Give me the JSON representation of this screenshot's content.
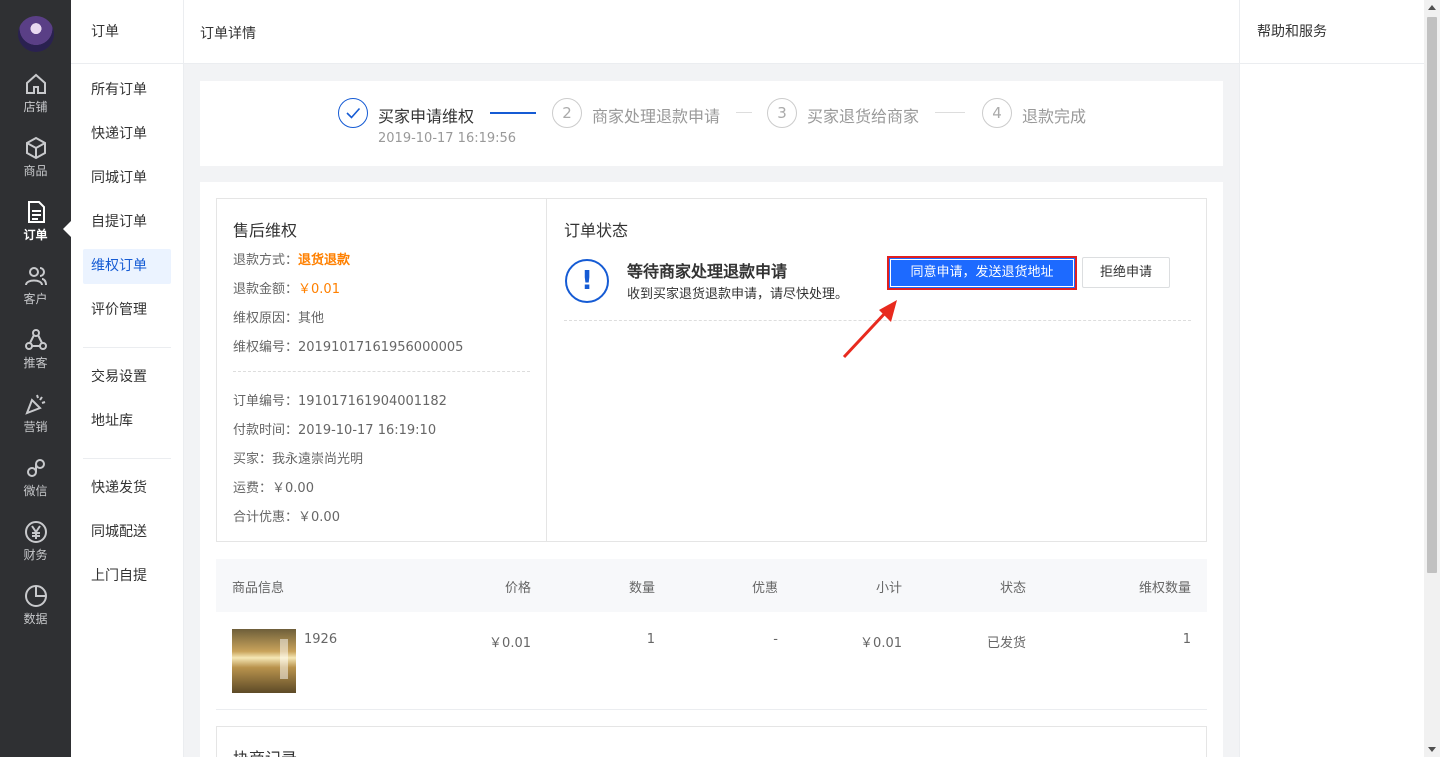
{
  "nav": {
    "items": [
      {
        "label": "店铺",
        "icon": "home-icon"
      },
      {
        "label": "商品",
        "icon": "cube-icon"
      },
      {
        "label": "订单",
        "icon": "document-icon",
        "active": true
      },
      {
        "label": "客户",
        "icon": "users-icon"
      },
      {
        "label": "推客",
        "icon": "share-nodes-icon"
      },
      {
        "label": "营销",
        "icon": "party-popper-icon"
      },
      {
        "label": "微信",
        "icon": "link-icon"
      },
      {
        "label": "财务",
        "icon": "yen-icon"
      },
      {
        "label": "数据",
        "icon": "pie-chart-icon"
      }
    ]
  },
  "sub_nav": {
    "title": "订单",
    "items": [
      "所有订单",
      "快递订单",
      "同城订单",
      "自提订单",
      "维权订单",
      "评价管理",
      "交易设置",
      "地址库",
      "快递发货",
      "同城配送",
      "上门自提"
    ],
    "active_index": 4
  },
  "header": {
    "title": "订单详情"
  },
  "help": {
    "title": "帮助和服务"
  },
  "steps": [
    {
      "index": "✓",
      "label": "买家申请维权",
      "time": "2019-10-17 16:19:56",
      "done": true
    },
    {
      "index": "2",
      "label": "商家处理退款申请"
    },
    {
      "index": "3",
      "label": "买家退货给商家"
    },
    {
      "index": "4",
      "label": "退款完成"
    }
  ],
  "after_sale": {
    "title": "售后维权",
    "refund_method_label": "退款方式：",
    "refund_method": "退货退款",
    "refund_amount_label": "退款金额：",
    "refund_amount": "￥0.01",
    "reason_label": "维权原因：",
    "reason": "其他",
    "case_no_label": "维权编号：",
    "case_no": "20191017161956000005",
    "order_no_label": "订单编号：",
    "order_no": "191017161904001182",
    "pay_time_label": "付款时间：",
    "pay_time": "2019-10-17 16:19:10",
    "buyer_label": "买家：",
    "buyer": "我永遠崇尚光明",
    "shipping_label": "运费：",
    "shipping": "￥0.00",
    "discount_label": "合计优惠：",
    "discount": "￥0.00"
  },
  "order_status": {
    "title": "订单状态",
    "status_title": "等待商家处理退款申请",
    "status_sub": "收到买家退货退款申请，请尽快处理。",
    "agree_button": "同意申请，发送退货地址",
    "reject_button": "拒绝申请"
  },
  "goods_table": {
    "headers": [
      "商品信息",
      "价格",
      "数量",
      "优惠",
      "小计",
      "状态",
      "维权数量"
    ],
    "rows": [
      {
        "name": "1926",
        "price": "￥0.01",
        "qty": "1",
        "discount": "-",
        "subtotal": "￥0.01",
        "status": "已发货",
        "refund_qty": "1"
      }
    ]
  },
  "negotiation": {
    "title": "协商记录"
  },
  "colors": {
    "primary": "#1d6aff",
    "highlight": "#e02020",
    "orange": "#ff8000",
    "nav_bg": "#2f3033"
  }
}
